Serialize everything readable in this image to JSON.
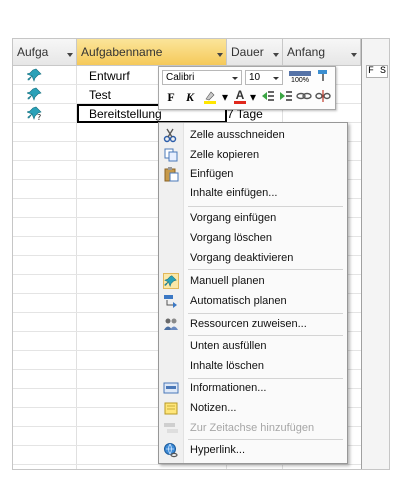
{
  "header": {
    "col_indicator": "Aufga",
    "col_name": "Aufgabenname",
    "col_duration": "Dauer",
    "col_start": "Anfang"
  },
  "gantt": {
    "days": "F S"
  },
  "rows": [
    {
      "name": "Entwurf",
      "duration": ""
    },
    {
      "name": "Test",
      "duration": ""
    },
    {
      "name": "Bereitstellung",
      "duration": "7 Tage"
    }
  ],
  "mini_toolbar": {
    "font": "Calibri",
    "size": "10",
    "zoom": "100%",
    "bold": "F",
    "italic": "K",
    "font_color_letter": "A"
  },
  "menu": {
    "items": [
      {
        "label": "Zelle ausschneiden",
        "icon": "scissors-icon",
        "disabled": false
      },
      {
        "label": "Zelle kopieren",
        "icon": "copy-icon",
        "disabled": false
      },
      {
        "label": "Einfügen",
        "icon": "paste-icon",
        "disabled": false
      },
      {
        "label": "Inhalte einfügen...",
        "icon": "",
        "disabled": false
      },
      {
        "label": "Vorgang einfügen",
        "icon": "",
        "disabled": false
      },
      {
        "label": "Vorgang löschen",
        "icon": "",
        "disabled": false
      },
      {
        "label": "Vorgang deaktivieren",
        "icon": "",
        "disabled": false
      },
      {
        "label": "Manuell planen",
        "icon": "pin-icon",
        "disabled": false
      },
      {
        "label": "Automatisch planen",
        "icon": "auto-schedule-icon",
        "disabled": false
      },
      {
        "label": "Ressourcen zuweisen...",
        "icon": "people-icon",
        "disabled": false
      },
      {
        "label": "Unten ausfüllen",
        "icon": "",
        "disabled": false
      },
      {
        "label": "Inhalte löschen",
        "icon": "",
        "disabled": false
      },
      {
        "label": "Informationen...",
        "icon": "info-card-icon",
        "disabled": false
      },
      {
        "label": "Notizen...",
        "icon": "note-icon",
        "disabled": false
      },
      {
        "label": "Zur Zeitachse hinzufügen",
        "icon": "timeline-icon",
        "disabled": true
      },
      {
        "label": "Hyperlink...",
        "icon": "hyperlink-icon",
        "disabled": false
      }
    ]
  }
}
